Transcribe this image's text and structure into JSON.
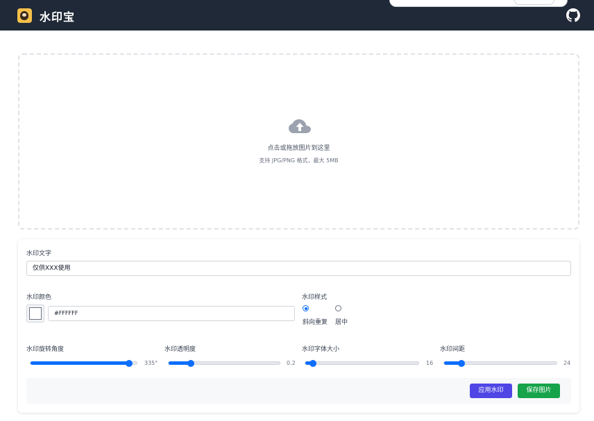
{
  "app": {
    "title": "水印宝"
  },
  "upload": {
    "prompt": "点击或拖放图片到这里",
    "hint": "支持 JPG/PNG 格式，最大 5MB"
  },
  "settings": {
    "text_label": "水印文字",
    "text_value": "仅供XXX使用",
    "color_label": "水印颜色",
    "color_value": "#FFFFFF",
    "style_label": "水印样式",
    "style_options": [
      "斜向重复",
      "居中"
    ],
    "style_selected": "斜向重复",
    "rotation": {
      "label": "水印旋转角度",
      "value": 335,
      "display": "335°",
      "min": 0,
      "max": 360
    },
    "opacity": {
      "label": "水印透明度",
      "value": 0.2,
      "display": "0.2",
      "min": 0,
      "max": 1
    },
    "font_size": {
      "label": "水印字体大小",
      "value": 16,
      "display": "16",
      "min": 10,
      "max": 100
    },
    "spacing": {
      "label": "水印间距",
      "value": 24,
      "display": "24",
      "min": 10,
      "max": 100
    }
  },
  "actions": {
    "apply_label": "应用水印",
    "save_label": "保存图片"
  },
  "colors": {
    "header": "#1f2937",
    "accent": "#0d6efd",
    "apply": "#4f46e5",
    "save": "#16a34a"
  }
}
